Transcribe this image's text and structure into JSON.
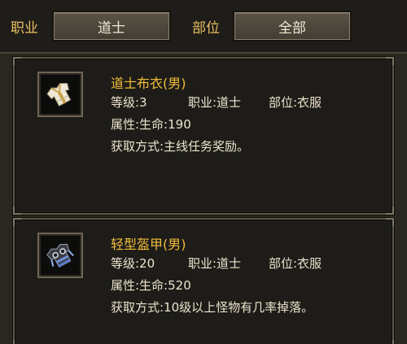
{
  "filters": {
    "job_label": "职业",
    "job_value": "道士",
    "slot_label": "部位",
    "slot_value": "全部"
  },
  "items": [
    {
      "icon": "taoist-robe-icon",
      "name": "道士布衣(男)",
      "level": "等级:3",
      "job": "职业:道士",
      "slot": "部位:衣服",
      "attr": "属性:生命:190",
      "source": "获取方式:主线任务奖励。"
    },
    {
      "icon": "light-armor-icon",
      "name": "轻型盔甲(男)",
      "level": "等级:20",
      "job": "职业:道士",
      "slot": "部位:衣服",
      "attr": "属性:生命:520",
      "source": "获取方式:10级以上怪物有几率掉落。"
    }
  ],
  "colors": {
    "label_gold": "#e8c060",
    "name_gold": "#f2bd3a",
    "text": "#ece3cd"
  }
}
